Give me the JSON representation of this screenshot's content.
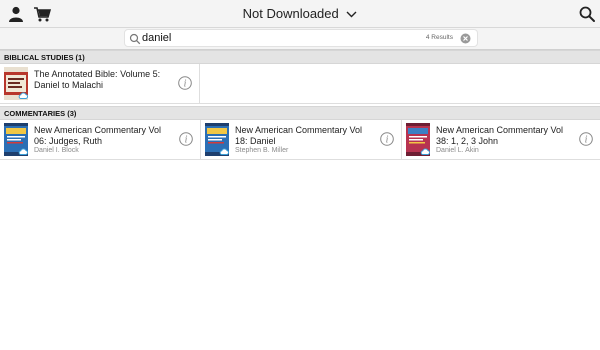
{
  "topbar": {
    "title": "Not Downloaded",
    "icons": [
      "user-icon",
      "cart-icon",
      "chevron-down-icon",
      "search-icon"
    ]
  },
  "search": {
    "query": "daniel",
    "results_count": "4 Results",
    "icons": [
      "search-icon",
      "clear-icon"
    ]
  },
  "sections": [
    {
      "header": "BIBLICAL STUDIES (1)",
      "books": [
        {
          "title_line1": "The Annotated Bible: Volume 5:",
          "title_line2": "Daniel to Malachi",
          "author": ""
        }
      ]
    },
    {
      "header": "COMMENTARIES (3)",
      "books": [
        {
          "title_line1": "New American Commentary Vol",
          "title_line2": "06: Judges, Ruth",
          "author": "Daniel I. Block"
        },
        {
          "title_line1": "New American Commentary Vol",
          "title_line2": "18: Daniel",
          "author": "Stephen B. Miller"
        },
        {
          "title_line1": "New American Commentary Vol",
          "title_line2": "38: 1, 2, 3 John",
          "author": "Daniel L. Akin"
        }
      ]
    }
  ],
  "colors": {
    "annotated_cover": "#b8372c",
    "nac_cover_blue": "#2b6fb5",
    "nac_cover_red": "#b73350",
    "cloud": "#3aa0d8"
  }
}
